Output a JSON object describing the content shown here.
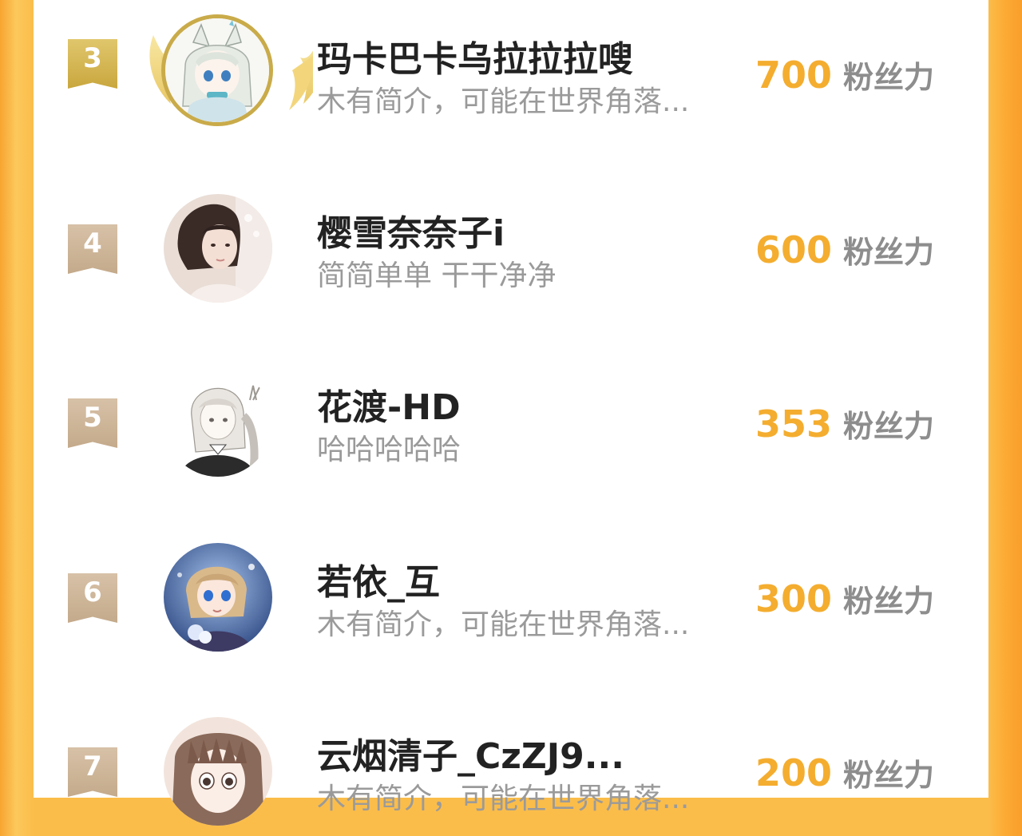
{
  "fans_label": "粉丝力",
  "colors": {
    "accent_orange": "#f4ad2f",
    "background_orange": "#fbbd4a",
    "rank_gold": "#d2b24f",
    "rank_tan": "#cbb295",
    "name_text": "#222222",
    "bio_text": "#9a9a9a"
  },
  "entries": [
    {
      "rank": "3",
      "name": "玛卡巴卡乌拉拉拉嗖",
      "bio": "木有简介，可能在世界角落...",
      "fans": "700",
      "avatar": "anime-cat-ear-avatar",
      "badge": "gold-crown-frame"
    },
    {
      "rank": "4",
      "name": "樱雪奈奈子i",
      "bio": "简简单单 干干净净",
      "fans": "600",
      "avatar": "girl-photo-avatar"
    },
    {
      "rank": "5",
      "name": "花渡-HD",
      "bio": "哈哈哈哈哈",
      "fans": "353",
      "avatar": "sketch-girl-avatar"
    },
    {
      "rank": "6",
      "name": "若依_互",
      "bio": "木有简介，可能在世界角落...",
      "fans": "300",
      "avatar": "blue-anime-avatar"
    },
    {
      "rank": "7",
      "name": "云烟清子_CzZJ9...",
      "bio": "木有简介，可能在世界角落...",
      "fans": "200",
      "avatar": "anime-bangs-avatar"
    }
  ]
}
